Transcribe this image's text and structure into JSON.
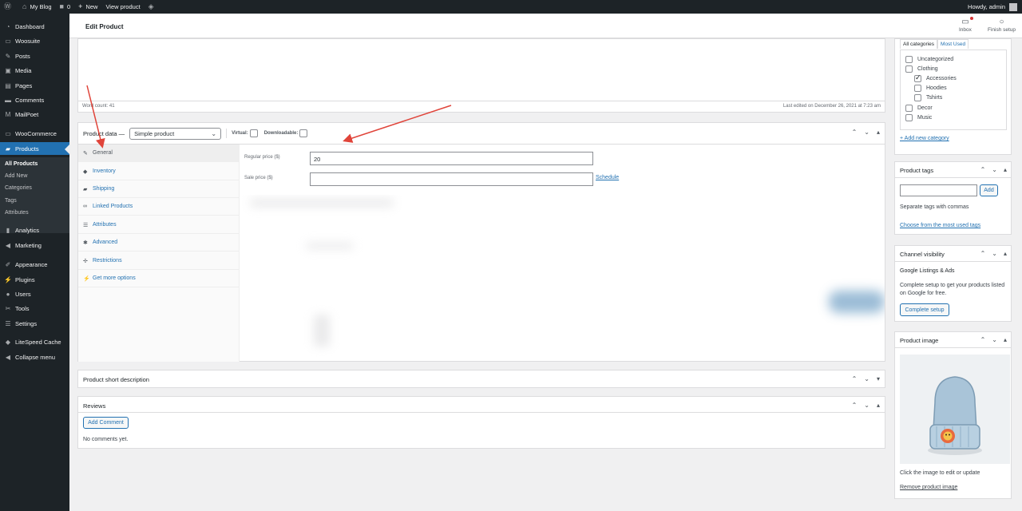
{
  "adminbar": {
    "site": "My Blog",
    "comments_count": "0",
    "new_label": "New",
    "view_label": "View product",
    "howdy": "Howdy, admin"
  },
  "sidebar": {
    "items": [
      {
        "label": "Dashboard",
        "icon": "dashboard-icon"
      },
      {
        "label": "Woosuite",
        "icon": "woosuite-icon"
      },
      {
        "label": "Posts",
        "icon": "pin-icon"
      },
      {
        "label": "Media",
        "icon": "media-icon"
      },
      {
        "label": "Pages",
        "icon": "pages-icon"
      },
      {
        "label": "Comments",
        "icon": "comments-icon"
      },
      {
        "label": "MailPoet",
        "icon": "mailpoet-icon"
      },
      {
        "label": "WooCommerce",
        "icon": "woocommerce-icon"
      },
      {
        "label": "Products",
        "icon": "products-icon"
      },
      {
        "label": "Analytics",
        "icon": "analytics-icon"
      },
      {
        "label": "Marketing",
        "icon": "marketing-icon"
      },
      {
        "label": "Appearance",
        "icon": "appearance-icon"
      },
      {
        "label": "Plugins",
        "icon": "plugins-icon"
      },
      {
        "label": "Users",
        "icon": "users-icon"
      },
      {
        "label": "Tools",
        "icon": "tools-icon"
      },
      {
        "label": "Settings",
        "icon": "settings-icon"
      },
      {
        "label": "LiteSpeed Cache",
        "icon": "litespeed-icon"
      },
      {
        "label": "Collapse menu",
        "icon": "collapse-icon"
      }
    ],
    "submenu": [
      "All Products",
      "Add New",
      "Categories",
      "Tags",
      "Attributes"
    ]
  },
  "header": {
    "title": "Edit Product",
    "inbox": "Inbox",
    "finish_setup": "Finish setup"
  },
  "editor": {
    "word_count": "Word count: 41",
    "last_edited": "Last edited on December 26, 2021 at 7:23 am"
  },
  "product_data": {
    "title": "Product data —",
    "type_select": "Simple product",
    "virtual": "Virtual:",
    "downloadable": "Downloadable:",
    "tabs": [
      {
        "label": "General",
        "icon": "wrench-icon"
      },
      {
        "label": "Inventory",
        "icon": "tag-icon"
      },
      {
        "label": "Shipping",
        "icon": "truck-icon"
      },
      {
        "label": "Linked Products",
        "icon": "link-icon"
      },
      {
        "label": "Attributes",
        "icon": "list-icon"
      },
      {
        "label": "Advanced",
        "icon": "gear-icon"
      },
      {
        "label": "Restrictions",
        "icon": "restrictions-icon"
      },
      {
        "label": "Get more options",
        "icon": "plugin-icon"
      }
    ],
    "regular_price_label": "Regular price ($)",
    "regular_price_value": "20",
    "sale_price_label": "Sale price ($)",
    "sale_price_value": "",
    "schedule": "Schedule"
  },
  "short_description": {
    "title": "Product short description"
  },
  "reviews": {
    "title": "Reviews",
    "add_comment": "Add Comment",
    "empty": "No comments yet."
  },
  "categories": {
    "tab_all": "All categories",
    "tab_most": "Most Used",
    "items": [
      {
        "label": "Uncategorized",
        "checked": false
      },
      {
        "label": "Clothing",
        "checked": false
      },
      {
        "label": "Accessories",
        "checked": true
      },
      {
        "label": "Hoodies",
        "checked": false
      },
      {
        "label": "Tshirts",
        "checked": false
      },
      {
        "label": "Decor",
        "checked": false
      },
      {
        "label": "Music",
        "checked": false
      }
    ],
    "add_new": "+ Add new category"
  },
  "tags": {
    "title": "Product tags",
    "add": "Add",
    "hint": "Separate tags with commas",
    "choose": "Choose from the most used tags"
  },
  "channel": {
    "title": "Channel visibility",
    "name": "Google Listings & Ads",
    "desc1": "Complete setup to get your products listed",
    "desc2": "on Google for free.",
    "button": "Complete setup"
  },
  "image": {
    "title": "Product image",
    "hint": "Click the image to edit or update",
    "remove": "Remove product image"
  },
  "colors": {
    "accent": "#2271b1",
    "adminbar": "#1d2327",
    "annotation": "#e0443a"
  }
}
